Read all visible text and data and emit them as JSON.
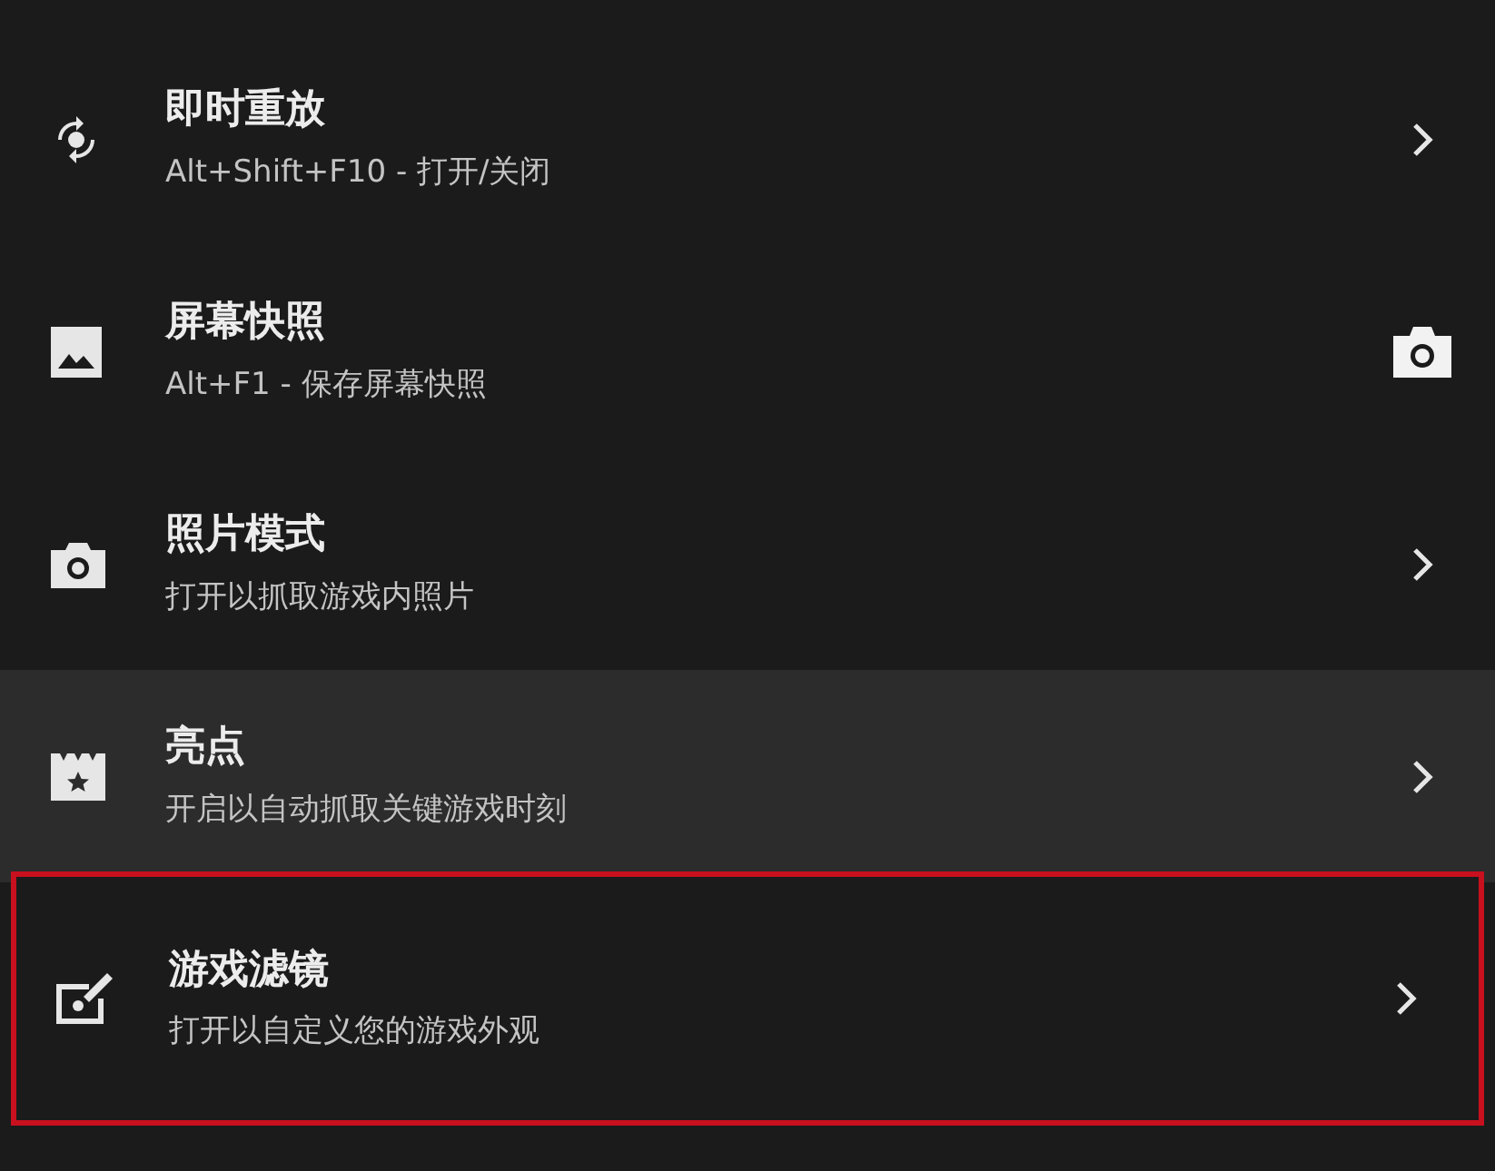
{
  "menu_items": [
    {
      "kind": "submenu",
      "title": "即时重放",
      "subtitle": "Alt+Shift+F10 - 打开/关闭",
      "selected": false,
      "outlined": false
    },
    {
      "kind": "capture",
      "title": "屏幕快照",
      "subtitle": "Alt+F1 - 保存屏幕快照",
      "selected": false,
      "outlined": false
    },
    {
      "kind": "submenu",
      "title": "照片模式",
      "subtitle": "打开以抓取游戏内照片",
      "selected": false,
      "outlined": false
    },
    {
      "kind": "submenu",
      "title": "亮点",
      "subtitle": "开启以自动抓取关键游戏时刻",
      "selected": true,
      "outlined": false
    },
    {
      "kind": "submenu",
      "title": "游戏滤镜",
      "subtitle": "打开以自定义您的游戏外观",
      "selected": false,
      "outlined": true
    }
  ]
}
